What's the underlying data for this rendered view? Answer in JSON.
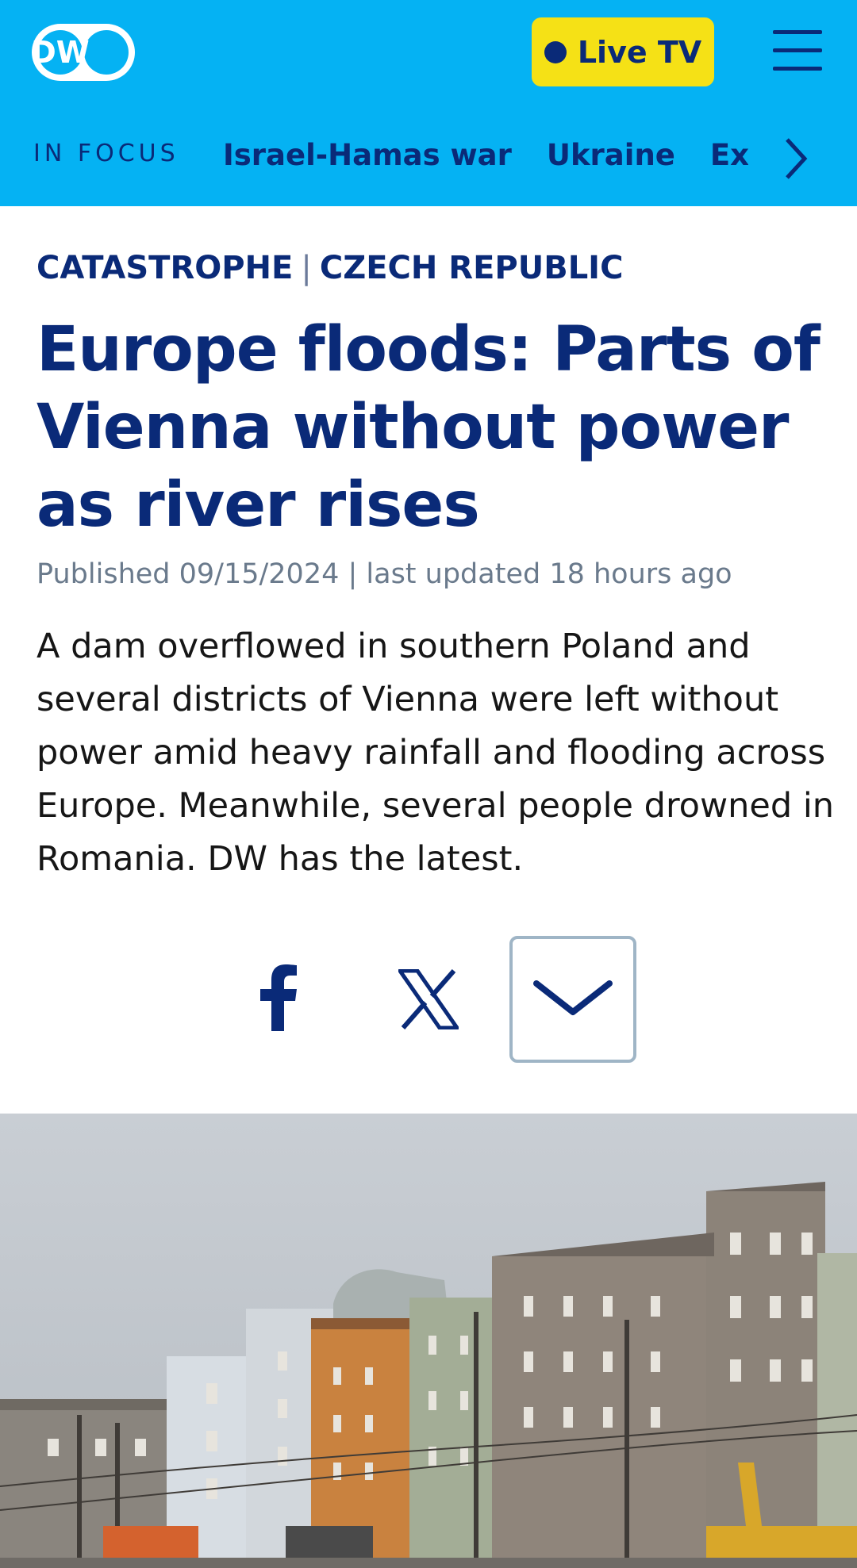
{
  "header": {
    "logo_text": "DW",
    "live_tv_label": "Live TV",
    "colors": {
      "bar": "#05b2f3",
      "live_button": "#f5e116",
      "navy": "#0a2a78"
    }
  },
  "in_focus": {
    "label": "IN FOCUS",
    "links": [
      {
        "label": "Israel-Hamas war"
      },
      {
        "label": "Ukraine"
      },
      {
        "label": "Extreme weather"
      }
    ]
  },
  "article": {
    "category_1": "CATASTROPHE",
    "separator": "|",
    "category_2": "CZECH REPUBLIC",
    "headline": "Europe floods: Parts of Vienna without power as river rises",
    "published": "Published 09/15/2024 | last updated 18 hours ago",
    "lead": "A dam overflowed in southern Poland and several districts of Vienna were left without power amid heavy rainfall and flooding across Europe. Meanwhile, several people drowned in Romania. DW has the latest."
  },
  "share": {
    "icons": [
      "facebook-icon",
      "x-icon",
      "chevron-down-icon"
    ]
  },
  "image": {
    "description_icon": "flooded-street-photo"
  }
}
